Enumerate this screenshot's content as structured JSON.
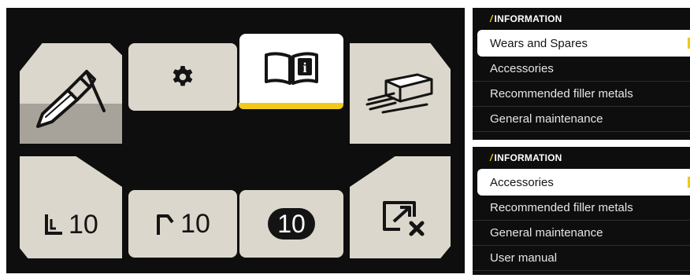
{
  "colors": {
    "panel_bg": "#0e0e0e",
    "tile": "#dcd7cc",
    "tile_selected": "#ffffff",
    "accent": "#f1c91a"
  },
  "menu": {
    "tiles": [
      {
        "id": "torch",
        "icon": "torch-icon",
        "selected": false
      },
      {
        "id": "settings",
        "icon": "gear-icon",
        "selected": false
      },
      {
        "id": "information",
        "icon": "book-info-icon",
        "selected": true
      },
      {
        "id": "electrodes",
        "icon": "electrodes-icon",
        "selected": false
      },
      {
        "id": "memory-1",
        "icon": "pulse-low-icon",
        "value": "10"
      },
      {
        "id": "memory-2",
        "icon": "pulse-high-icon",
        "value": "10"
      },
      {
        "id": "memory-3",
        "icon": "memory-badge-icon",
        "value": "10"
      },
      {
        "id": "exit",
        "icon": "exit-screen-icon",
        "selected": false
      }
    ]
  },
  "info_top": {
    "header": "INFORMATION",
    "items": [
      "Wears and Spares",
      "Accessories",
      "Recommended filler metals",
      "General maintenance"
    ],
    "active_index": 0
  },
  "info_bottom": {
    "header": "INFORMATION",
    "items": [
      "Accessories",
      "Recommended filler metals",
      "General maintenance",
      "User manual"
    ],
    "active_index": 0
  }
}
